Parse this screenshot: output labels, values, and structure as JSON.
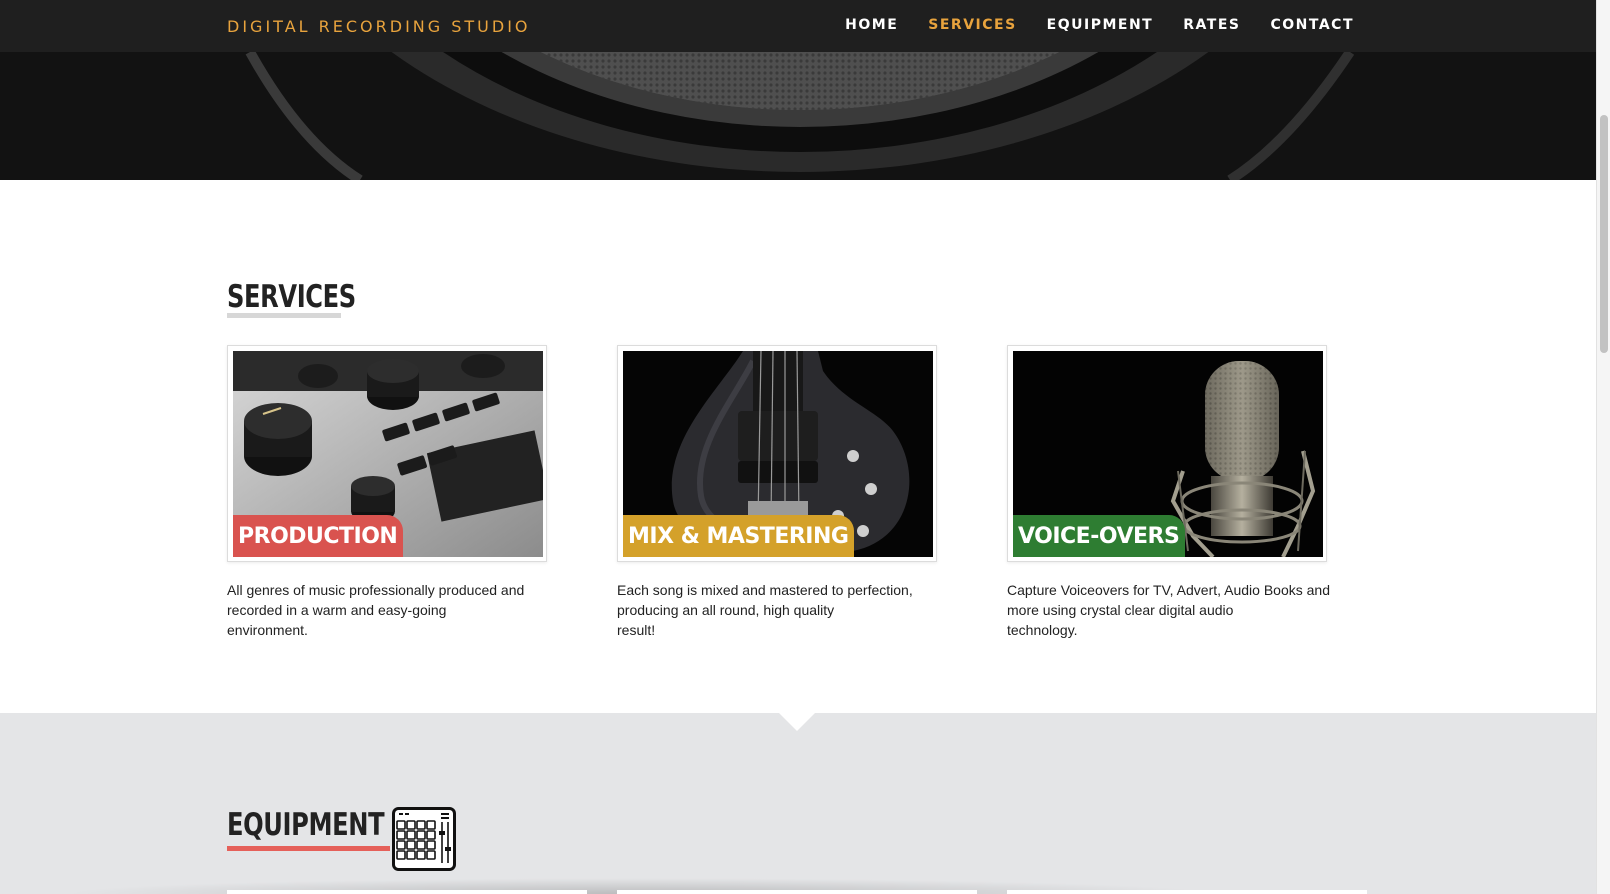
{
  "brand": "DIGITAL RECORDING STUDIO",
  "nav": {
    "items": [
      "HOME",
      "SERVICES",
      "EQUIPMENT",
      "RATES",
      "CONTACT"
    ],
    "active": "SERVICES"
  },
  "services": {
    "title": "SERVICES",
    "cards": [
      {
        "label": "PRODUCTION",
        "image": "mixing-console-knobs",
        "label_color": "#d9534f",
        "description": [
          "All genres of music professionally produced and",
          "recorded in a warm and easy-going",
          "environment."
        ]
      },
      {
        "label": "MIX & MASTERING",
        "image": "bass-guitar",
        "label_color": "#d4a12a",
        "description": [
          "Each song is mixed and mastered to perfection,",
          "producing an all round, high quality",
          "result!"
        ]
      },
      {
        "label": "VOICE-OVERS",
        "image": "studio-microphone",
        "label_color": "#2e7d32",
        "description": [
          "Capture Voiceovers for TV, Advert, Audio Books and",
          "more using crystal clear digital audio",
          "technology."
        ]
      }
    ]
  },
  "equipment": {
    "title": "EQUIPMENT",
    "icon": "drum-pad-controller-icon",
    "underline_color": "#e5605a"
  },
  "colors": {
    "accent": "#e8a33d",
    "navbar": "#1f1f1f",
    "equipment_bg": "#e4e5e7"
  }
}
